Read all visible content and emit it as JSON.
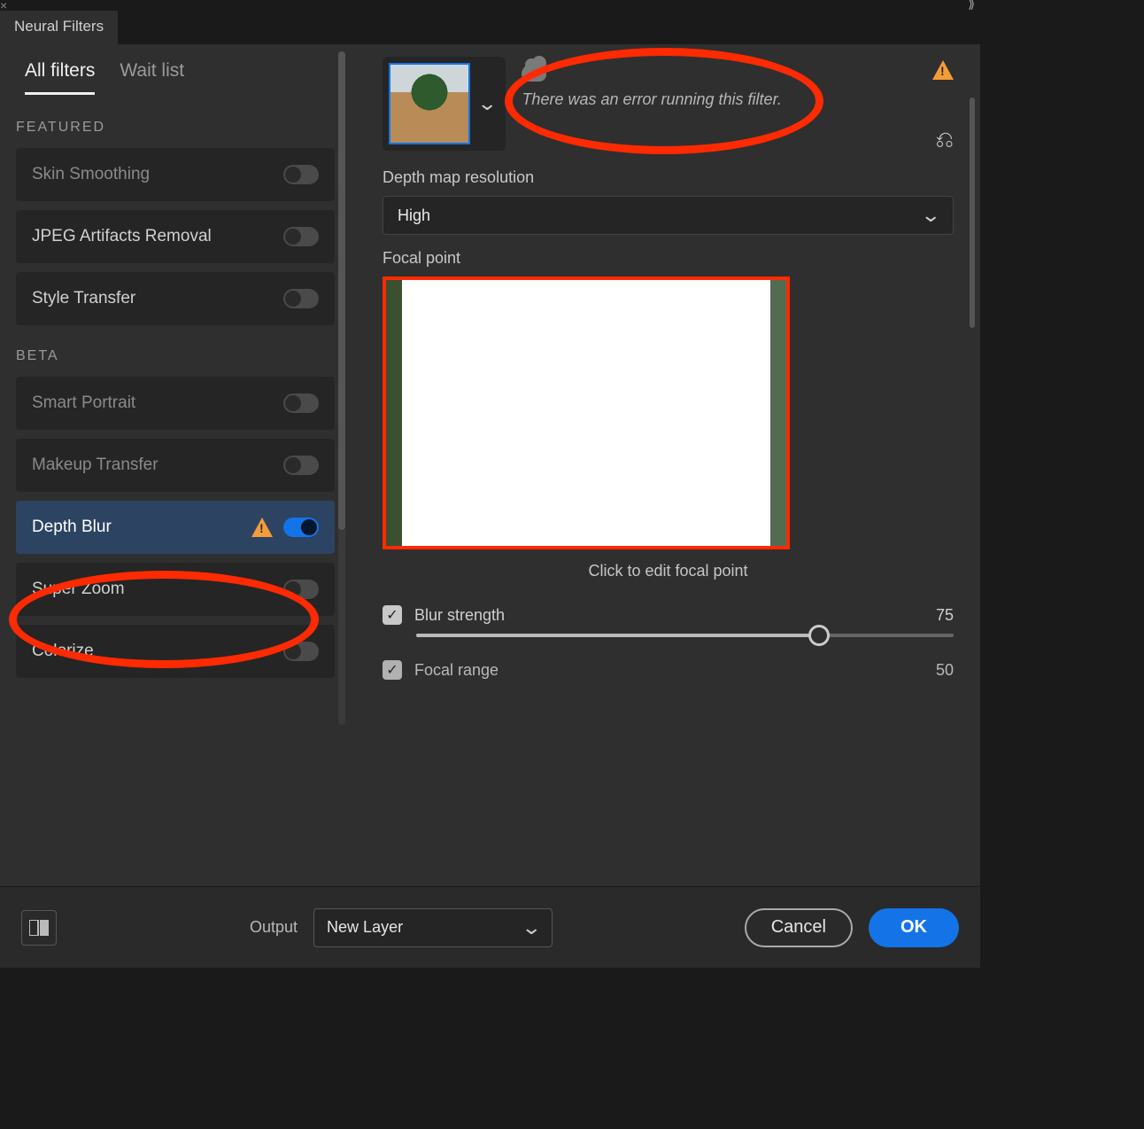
{
  "window": {
    "title": "Neural Filters"
  },
  "subtabs": {
    "all": "All filters",
    "wait": "Wait list"
  },
  "sections": {
    "featured": "FEATURED",
    "beta": "BETA"
  },
  "filters": {
    "skin": "Skin Smoothing",
    "jpeg": "JPEG Artifacts Removal",
    "style": "Style Transfer",
    "smart": "Smart Portrait",
    "makeup": "Makeup Transfer",
    "depth": "Depth Blur",
    "zoom": "Super Zoom",
    "colorize": "Colorize"
  },
  "panel": {
    "error": "There was an error running this filter.",
    "depth_label": "Depth map resolution",
    "depth_value": "High",
    "focal_label": "Focal point",
    "focal_caption": "Click to edit focal point",
    "blur_label": "Blur strength",
    "blur_value": "75",
    "focal_range_label": "Focal range",
    "focal_range_value": "50"
  },
  "footer": {
    "output_label": "Output",
    "output_value": "New Layer",
    "cancel": "Cancel",
    "ok": "OK"
  }
}
